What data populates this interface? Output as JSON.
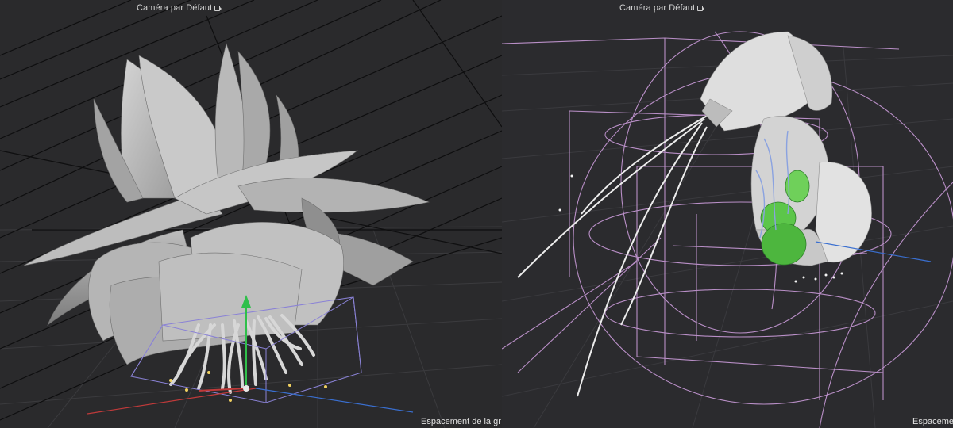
{
  "viewports": {
    "left": {
      "camera_label": "Caméra par Défaut",
      "camera_icon": "camera-icon",
      "grid_spacing_label": "Espacement de la gr"
    },
    "right": {
      "camera_label": "Caméra par Défaut",
      "camera_icon": "camera-icon",
      "grid_spacing_label": "Espaceme"
    }
  },
  "colors": {
    "background": "#2b2b2d",
    "grid_line": "#3a3a3d",
    "wire_black": "#0f0f10",
    "model_gray": "#c8c8c8",
    "bounding_box": "#8a82d6",
    "deformer_pink": "#c99ad8",
    "axis_x": "#c03a3a",
    "axis_y": "#2fbf4a",
    "axis_z": "#3a6fd0",
    "selection_green": "#3fae3a"
  }
}
